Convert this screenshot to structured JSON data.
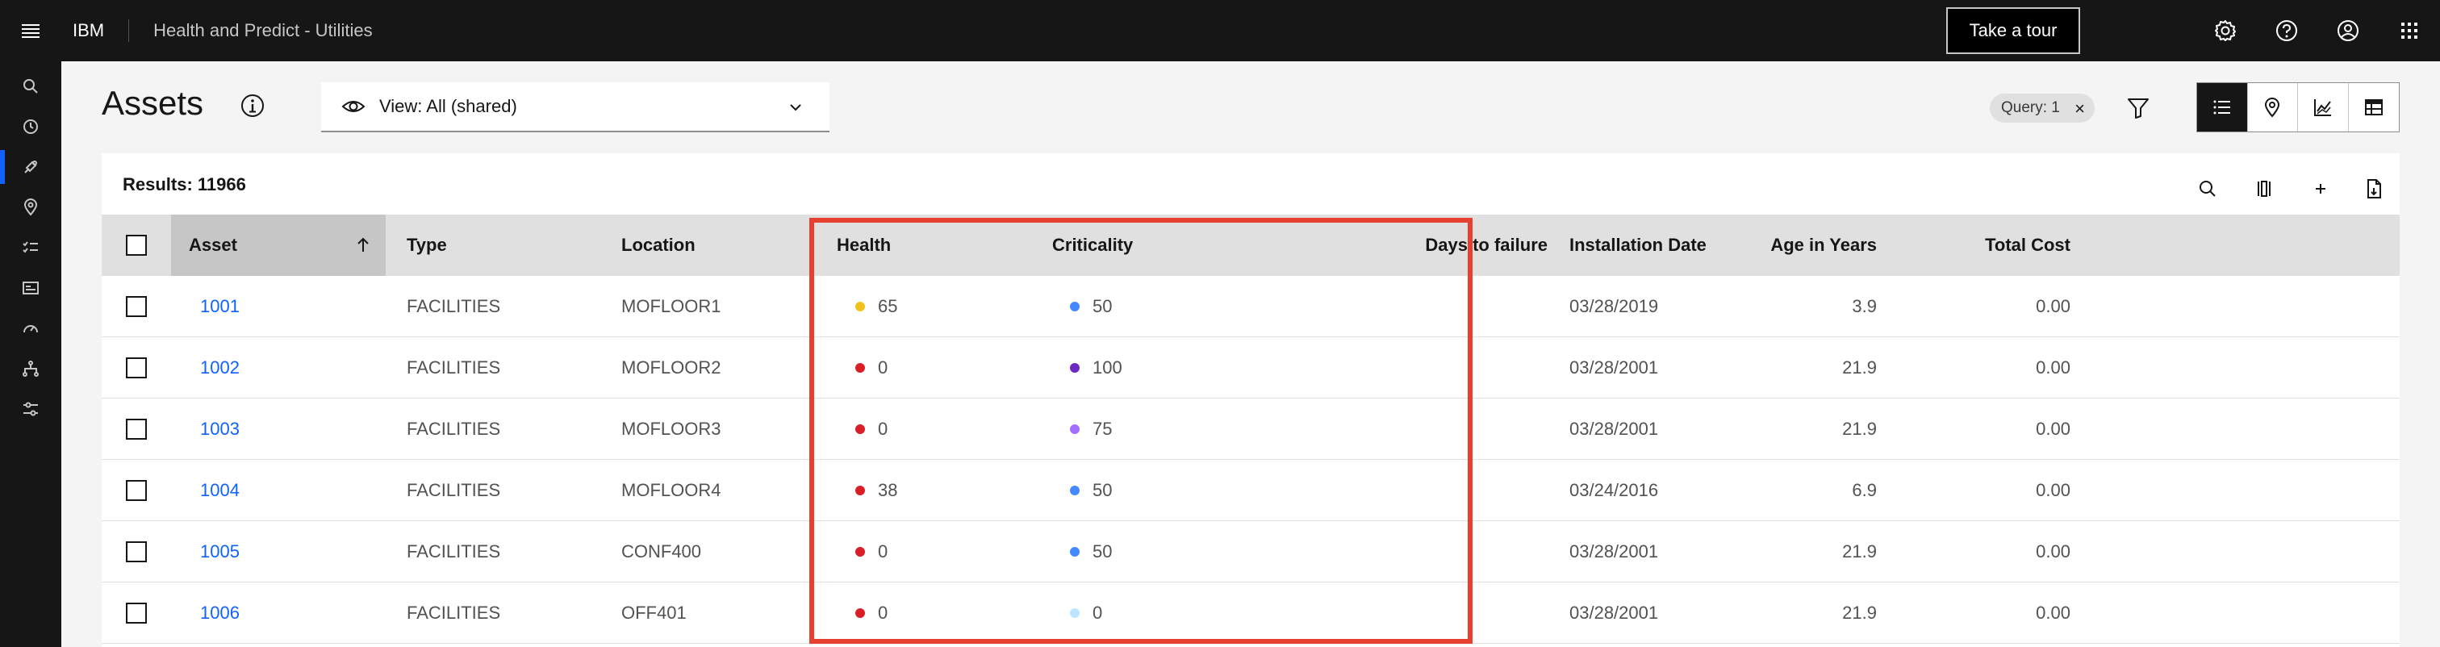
{
  "header": {
    "brand": "IBM",
    "product": "Health and Predict - Utilities",
    "tour_label": "Take a tour"
  },
  "page": {
    "title": "Assets",
    "view_label": "View: All (shared)",
    "query_tag": "Query: 1",
    "query_clear": "×"
  },
  "results": "Results: 11966",
  "columns": {
    "asset": "Asset",
    "type": "Type",
    "location": "Location",
    "health": "Health",
    "criticality": "Criticality",
    "days_to_failure": "Days to failure",
    "installation_date": "Installation Date",
    "age_in_years": "Age in Years",
    "total_cost": "Total Cost"
  },
  "colors": {
    "health_yellow": "#f1c21b",
    "health_red": "#da1e28",
    "crit_blue": "#4589ff",
    "crit_purple_dark": "#6929c4",
    "crit_purple": "#a56eff",
    "crit_light": "#bae6ff",
    "highlight": "#e8402f"
  },
  "rows": [
    {
      "asset": "1001",
      "type": "FACILITIES",
      "location": "MOFLOOR1",
      "health": "65",
      "health_color": "#f1c21b",
      "criticality": "50",
      "crit_color": "#4589ff",
      "installation_date": "03/28/2019",
      "age": "3.9",
      "cost": "0.00"
    },
    {
      "asset": "1002",
      "type": "FACILITIES",
      "location": "MOFLOOR2",
      "health": "0",
      "health_color": "#da1e28",
      "criticality": "100",
      "crit_color": "#6929c4",
      "installation_date": "03/28/2001",
      "age": "21.9",
      "cost": "0.00"
    },
    {
      "asset": "1003",
      "type": "FACILITIES",
      "location": "MOFLOOR3",
      "health": "0",
      "health_color": "#da1e28",
      "criticality": "75",
      "crit_color": "#a56eff",
      "installation_date": "03/28/2001",
      "age": "21.9",
      "cost": "0.00"
    },
    {
      "asset": "1004",
      "type": "FACILITIES",
      "location": "MOFLOOR4",
      "health": "38",
      "health_color": "#da1e28",
      "criticality": "50",
      "crit_color": "#4589ff",
      "installation_date": "03/24/2016",
      "age": "6.9",
      "cost": "0.00"
    },
    {
      "asset": "1005",
      "type": "FACILITIES",
      "location": "CONF400",
      "health": "0",
      "health_color": "#da1e28",
      "criticality": "50",
      "crit_color": "#4589ff",
      "installation_date": "03/28/2001",
      "age": "21.9",
      "cost": "0.00"
    },
    {
      "asset": "1006",
      "type": "FACILITIES",
      "location": "OFF401",
      "health": "0",
      "health_color": "#da1e28",
      "criticality": "0",
      "crit_color": "#bae6ff",
      "installation_date": "03/28/2001",
      "age": "21.9",
      "cost": "0.00"
    }
  ]
}
